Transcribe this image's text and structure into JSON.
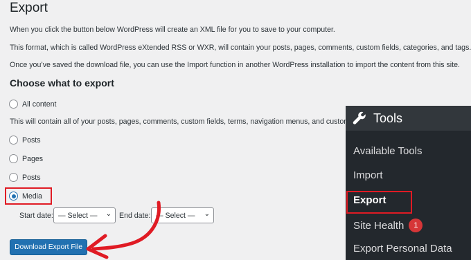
{
  "page": {
    "title": "Export",
    "intro": [
      "When you click the button below WordPress will create an XML file for you to save to your computer.",
      "This format, which is called WordPress eXtended RSS or WXR, will contain your posts, pages, comments, custom fields, categories, and tags.",
      "Once you’ve saved the download file, you can use the Import function in another WordPress installation to import the content from this site."
    ],
    "section_title": "Choose what to export",
    "options": {
      "all": "All content",
      "all_desc": "This will contain all of your posts, pages, comments, custom fields, terms, navigation menus, and custom posts.",
      "posts": "Posts",
      "pages": "Pages",
      "posts2": "Posts",
      "media": "Media"
    },
    "selected_option": "media",
    "start_date_label": "Start date:",
    "end_date_label": "End date:",
    "start_select": "— Select —",
    "end_select": "— Select —",
    "download_button": "Download Export File"
  },
  "sidebar": {
    "title": "Tools",
    "items": [
      "Available Tools",
      "Import",
      "Export",
      "Site Health",
      "Export Personal Data"
    ],
    "active": "Export",
    "site_health_badge": "1"
  },
  "colors": {
    "accent": "#2271b1",
    "highlight": "#e01b24",
    "sidebar_bg": "#23282d",
    "badge": "#d63638"
  }
}
